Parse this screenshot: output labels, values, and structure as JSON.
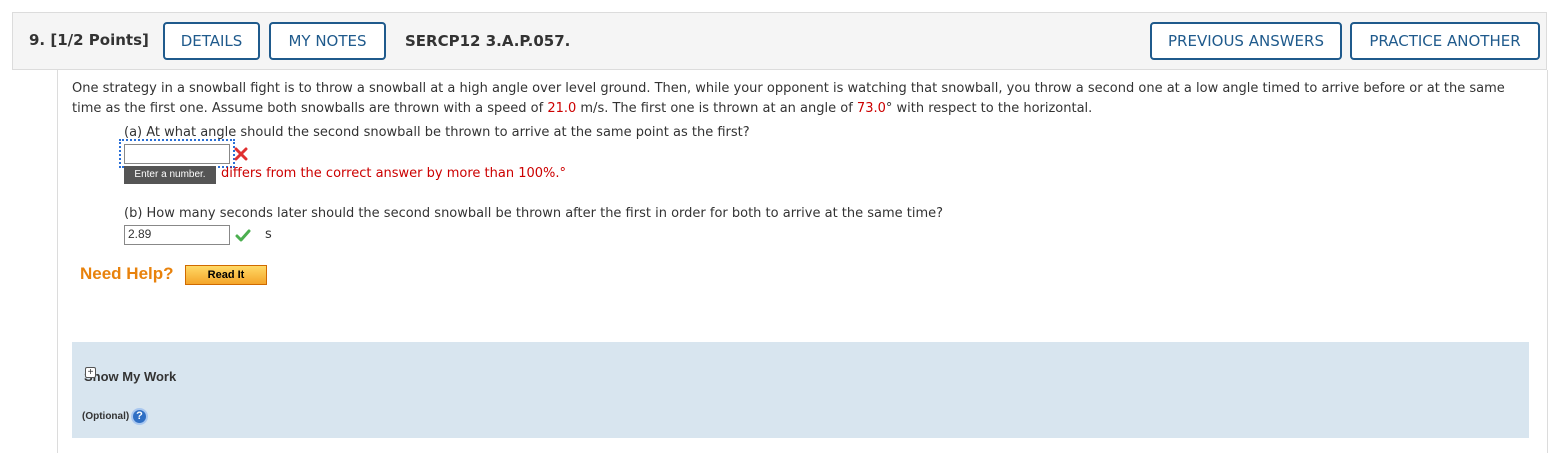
{
  "header": {
    "question_number": "9.",
    "points": "[1/2 Points]",
    "details_label": "DETAILS",
    "my_notes_label": "MY NOTES",
    "problem_code": "SERCP12 3.A.P.057.",
    "previous_answers_label": "PREVIOUS ANSWERS",
    "practice_another_label": "PRACTICE ANOTHER"
  },
  "problem": {
    "text_1": "One strategy in a snowball fight is to throw a snowball at a high angle over level ground. Then, while your opponent is watching that snowball, you throw a second one at a low angle timed to arrive before or at the same time as the first one. Assume both snowballs are thrown with a speed of ",
    "speed_value": "21.0",
    "text_2": " m/s. The first one is thrown at an angle of ",
    "angle_value": "73.0",
    "text_3": "° with respect to the horizontal."
  },
  "part_a": {
    "label": "(a) At what angle should the second snowball be thrown to arrive at the same point as the first?",
    "value": "",
    "tooltip": "Enter a number.",
    "feedback": "differs from the correct answer by more than 100%.°"
  },
  "part_b": {
    "label": "(b) How many seconds later should the second snowball be thrown after the first in order for both to arrive at the same time?",
    "value": "2.89",
    "unit": "s"
  },
  "help": {
    "need_help": "Need Help?",
    "read_it": "Read It"
  },
  "show_my_work": {
    "label": "Show My Work",
    "optional": "(Optional)"
  },
  "colors": {
    "accent": "#1f5a8c",
    "error": "#cc0000",
    "help_orange": "#e8820c",
    "work_panel": "#d8e5ef"
  }
}
